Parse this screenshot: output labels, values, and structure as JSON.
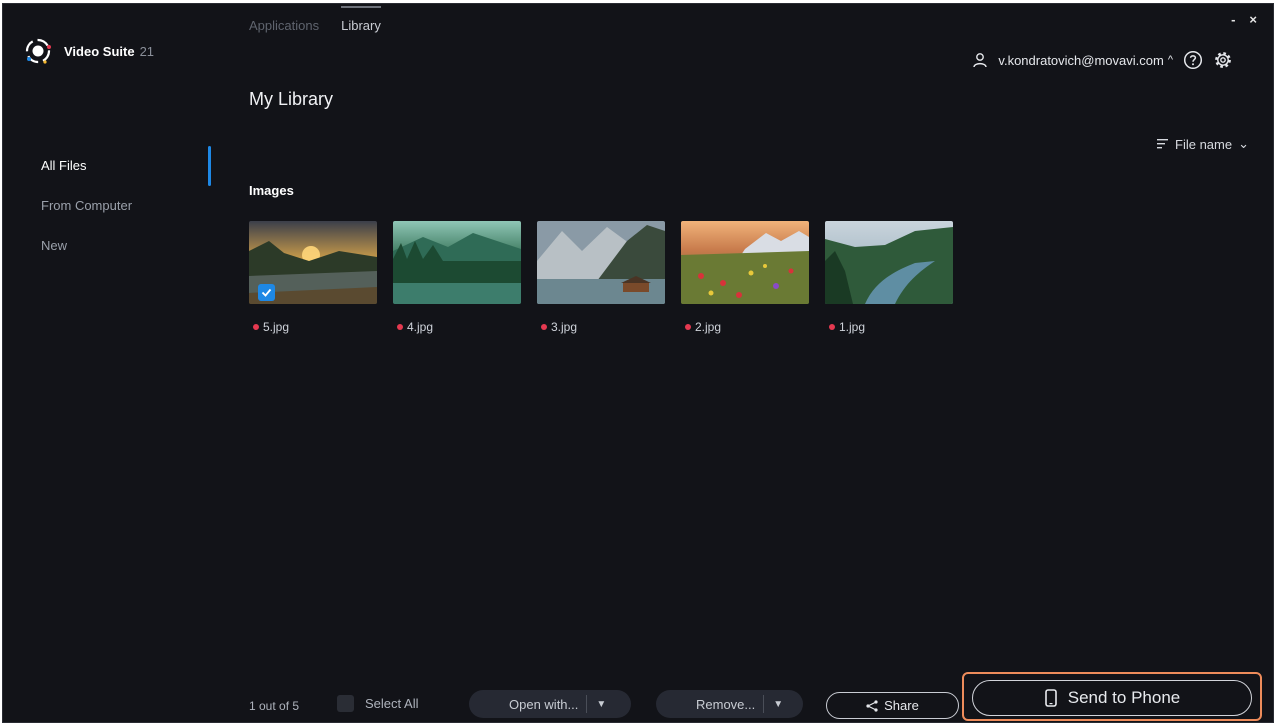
{
  "app": {
    "name": "Video Suite",
    "version": "21"
  },
  "top_tabs": [
    {
      "label": "Applications",
      "active": false
    },
    {
      "label": "Library",
      "active": true
    }
  ],
  "window_controls": {
    "minimize": "-",
    "close": "×"
  },
  "account": {
    "email": "v.kondratovich@movavi.com",
    "chevron": "^"
  },
  "sidebar": {
    "items": [
      {
        "label": "All Files",
        "active": true
      },
      {
        "label": "From Computer",
        "active": false
      },
      {
        "label": "New",
        "active": false
      }
    ]
  },
  "page_title": "My Library",
  "sort": {
    "label": "File name",
    "icon": "sort-icon",
    "chevron": "⌄"
  },
  "section_title": "Images",
  "files": [
    {
      "name": "5.jpg",
      "selected": true,
      "scene": "sunset-forest"
    },
    {
      "name": "4.jpg",
      "selected": false,
      "scene": "green-lake"
    },
    {
      "name": "3.jpg",
      "selected": false,
      "scene": "mountain-lake-cabin"
    },
    {
      "name": "2.jpg",
      "selected": false,
      "scene": "flower-meadow"
    },
    {
      "name": "1.jpg",
      "selected": false,
      "scene": "river-valley"
    }
  ],
  "bottom_bar": {
    "count": "1 out of 5",
    "select_all": "Select All",
    "open_with": "Open with...",
    "remove": "Remove...",
    "share": "Share",
    "send_to_phone": "Send to Phone"
  },
  "colors": {
    "background": "#121318",
    "accent": "#1e88e5",
    "new_dot": "#e53950",
    "highlight": "#ee8c5b"
  }
}
